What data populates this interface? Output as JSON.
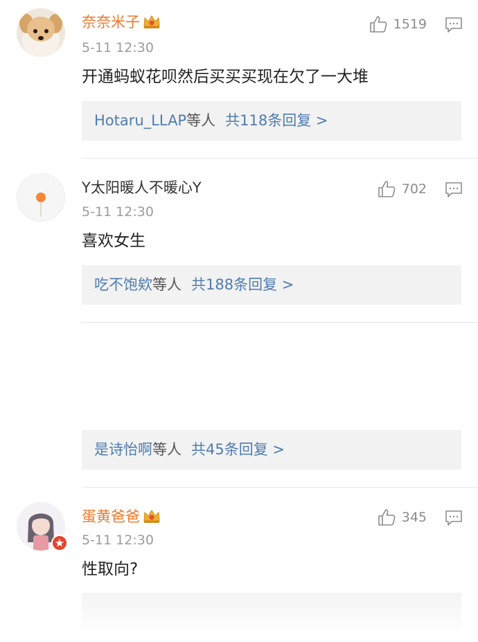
{
  "comments": [
    {
      "username": "奈奈米子",
      "time": "5-11 12:30",
      "likes": "1519",
      "text": "开通蚂蚁花呗然后买买买现在欠了一大堆",
      "replies": {
        "users": "Hotaru_LLAP",
        "others": "等人",
        "count": "共118条回复 >"
      }
    },
    {
      "username": "Y太阳暖人不暖心Y",
      "time": "5-11 12:30",
      "likes": "702",
      "text": "喜欢女生",
      "replies": {
        "users": "吃不饱欸",
        "others": "等人",
        "count": "共188条回复 >"
      }
    },
    {
      "replies": {
        "users": "是诗怡啊",
        "others": "等人",
        "count": "共45条回复 >"
      }
    },
    {
      "username": "蛋黄爸爸",
      "time": "5-11 12:30",
      "likes": "345",
      "text": "性取向?"
    }
  ],
  "colors": {
    "vip_name": "#e8792d",
    "link": "#4e7cb0",
    "reply_bg": "#f2f2f2"
  },
  "icons": [
    "vip-crown-icon",
    "thumbs-up-icon",
    "comment-reply-icon"
  ]
}
